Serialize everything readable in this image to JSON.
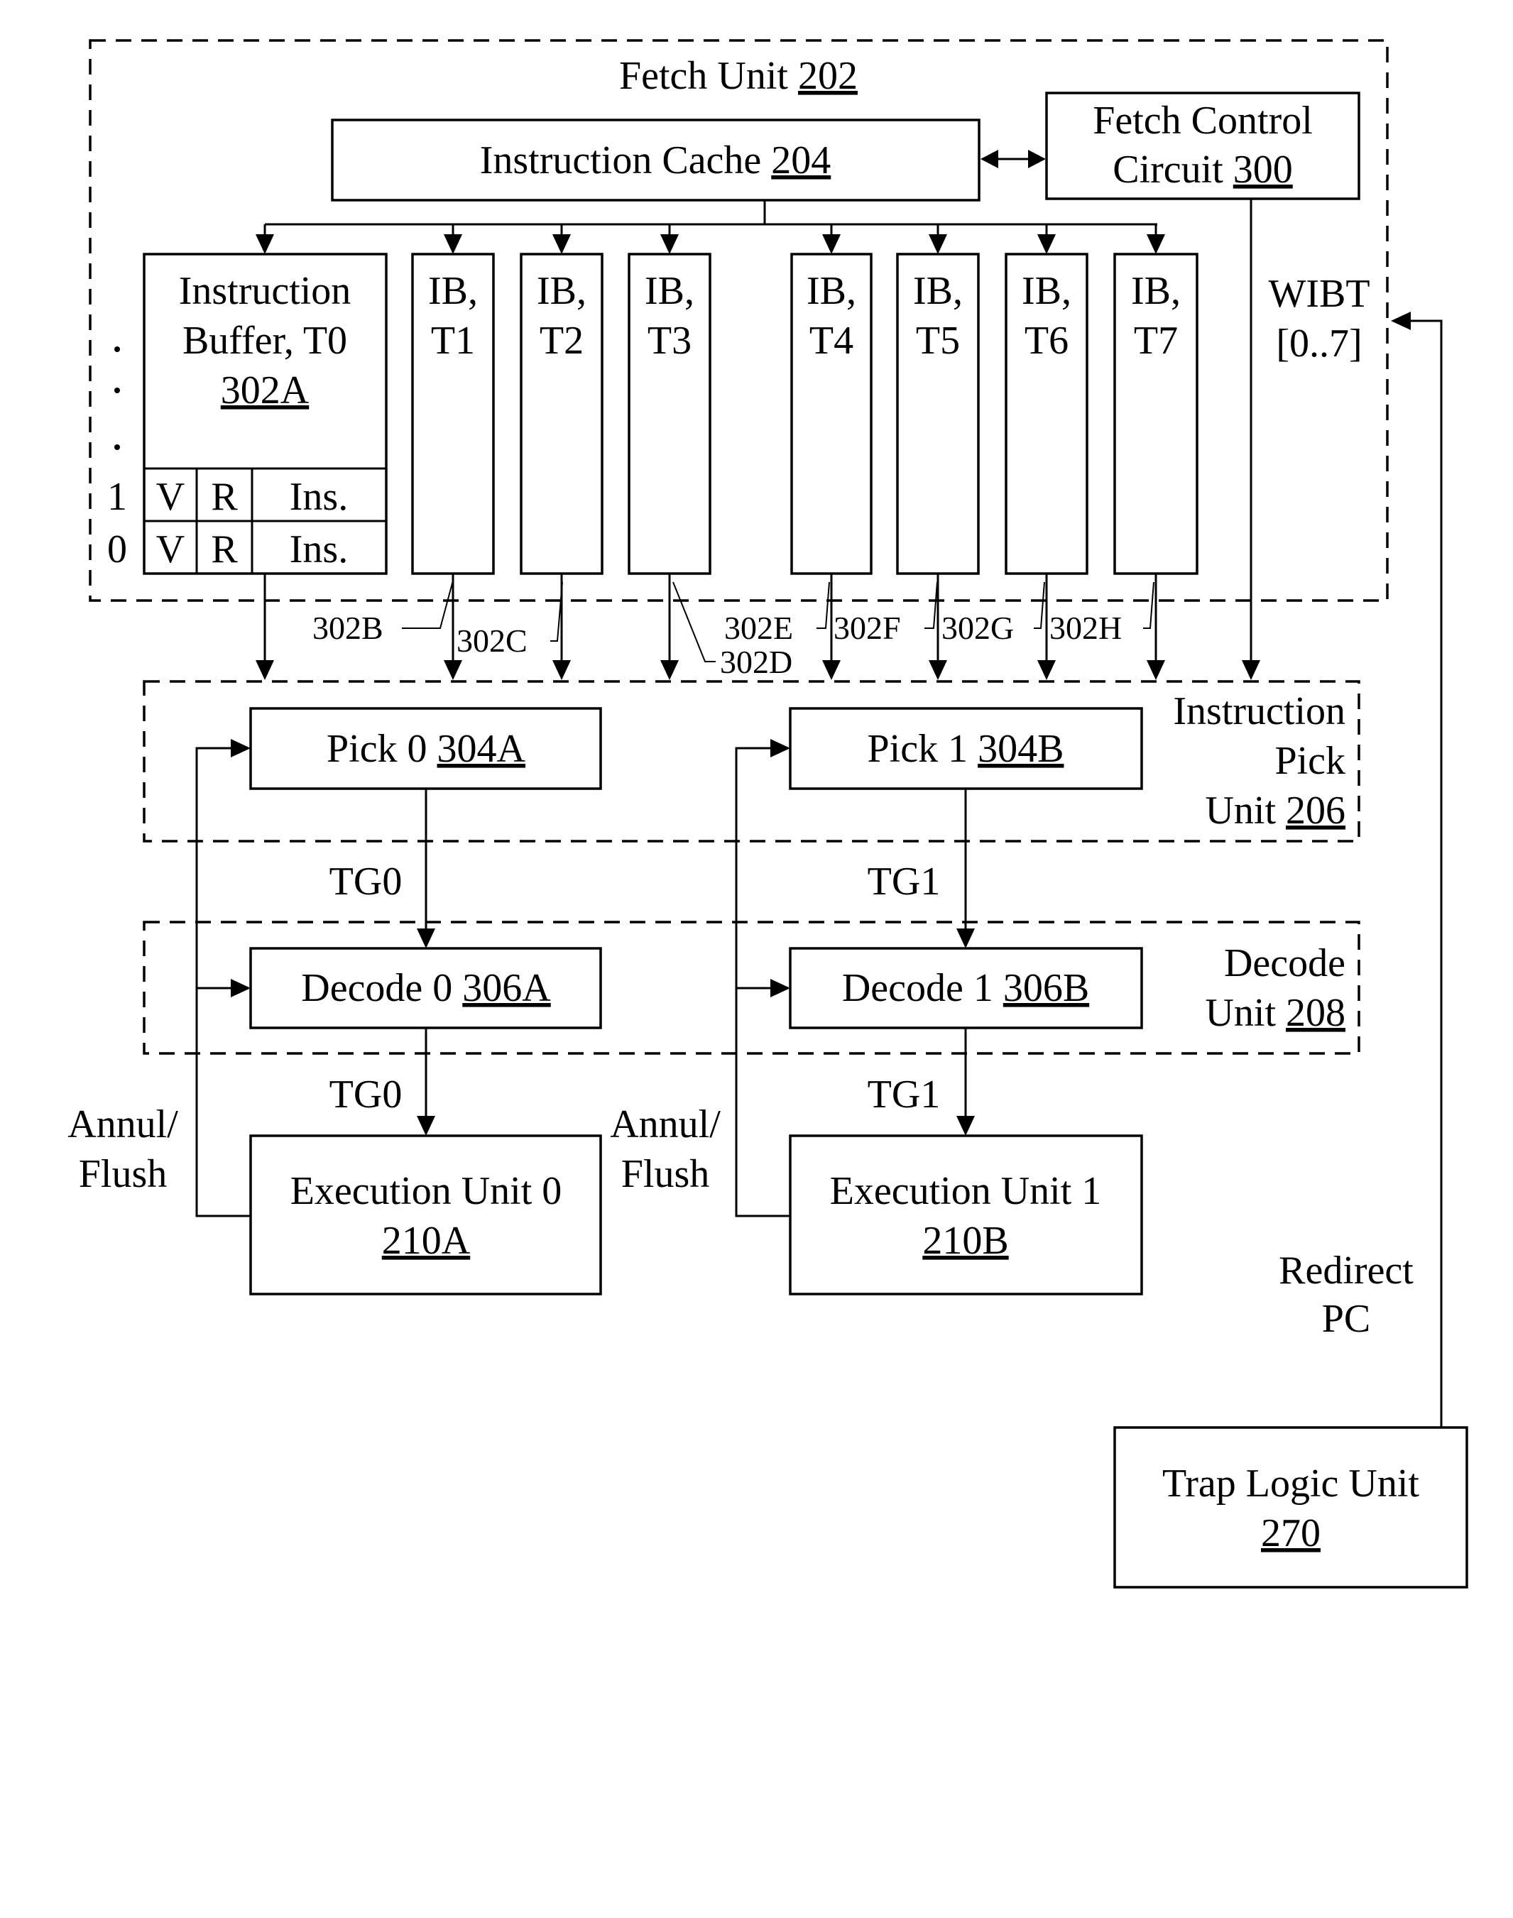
{
  "diagram": {
    "fetch_unit": {
      "label": "Fetch Unit",
      "ref": "202"
    },
    "instruction_cache": {
      "label": "Instruction Cache",
      "ref": "204"
    },
    "fetch_control": {
      "line1": "Fetch Control",
      "line2": "Circuit",
      "ref": "300"
    },
    "ib_t0": {
      "line1": "Instruction",
      "line2": "Buffer, T0",
      "ref": "302A",
      "rows": [
        {
          "index": "1",
          "v": "V",
          "r": "R",
          "ins": "Ins."
        },
        {
          "index": "0",
          "v": "V",
          "r": "R",
          "ins": "Ins."
        }
      ],
      "ellipsis": [
        "·",
        "·",
        "·"
      ]
    },
    "instruction_buffers": [
      {
        "line1": "IB,",
        "line2": "T1",
        "ref": "302B"
      },
      {
        "line1": "IB,",
        "line2": "T2",
        "ref": "302C"
      },
      {
        "line1": "IB,",
        "line2": "T3",
        "ref": "302D"
      },
      {
        "line1": "IB,",
        "line2": "T4",
        "ref": "302E"
      },
      {
        "line1": "IB,",
        "line2": "T5",
        "ref": "302F"
      },
      {
        "line1": "IB,",
        "line2": "T6",
        "ref": "302G"
      },
      {
        "line1": "IB,",
        "line2": "T7",
        "ref": "302H"
      }
    ],
    "wibt": {
      "line1": "WIBT",
      "line2": "[0..7]"
    },
    "pick_unit": {
      "line1": "Instruction",
      "line2": "Pick",
      "line3": "Unit",
      "ref": "206"
    },
    "pick0": {
      "label": "Pick 0",
      "ref": "304A"
    },
    "pick1": {
      "label": "Pick 1",
      "ref": "304B"
    },
    "decode_unit": {
      "line1": "Decode",
      "line2": "Unit",
      "ref": "208"
    },
    "decode0": {
      "label": "Decode 0",
      "ref": "306A"
    },
    "decode1": {
      "label": "Decode 1",
      "ref": "306B"
    },
    "tg0_label": "TG0",
    "tg1_label": "TG1",
    "exec0": {
      "line1": "Execution Unit 0",
      "ref": "210A"
    },
    "exec1": {
      "line1": "Execution Unit 1",
      "ref": "210B"
    },
    "annul_flush": {
      "line1": "Annul/",
      "line2": "Flush"
    },
    "redirect_pc": {
      "line1": "Redirect",
      "line2": "PC"
    },
    "trap_logic": {
      "line1": "Trap Logic Unit",
      "ref": "270"
    }
  }
}
